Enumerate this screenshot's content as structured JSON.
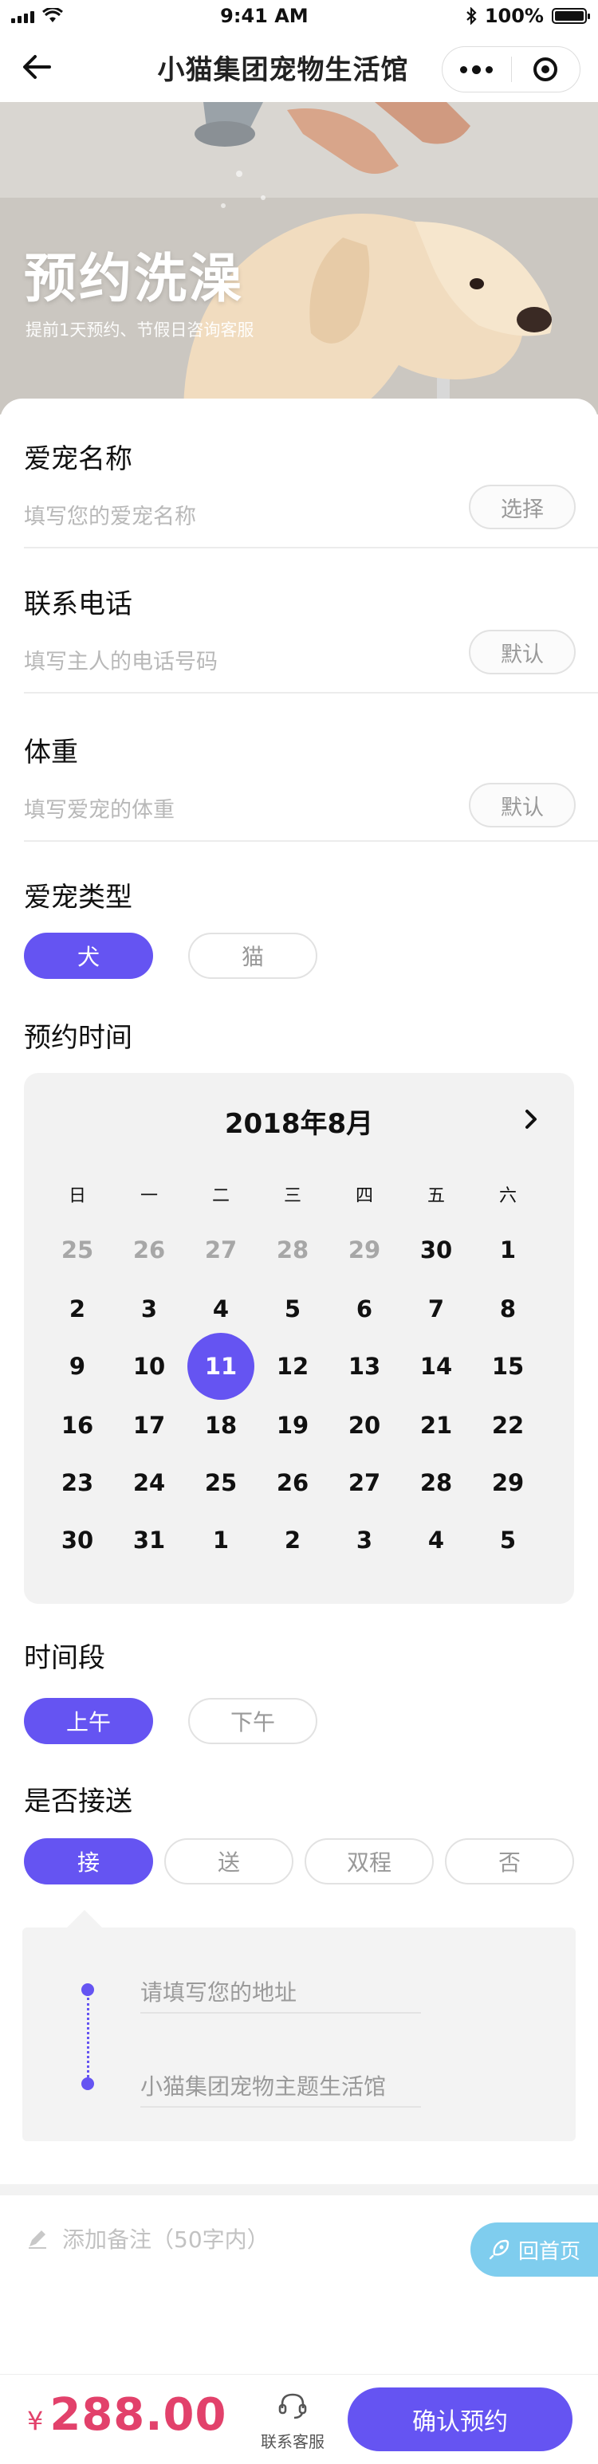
{
  "status_bar": {
    "time": "9:41 AM",
    "battery": "100%",
    "battery_level": 1.0
  },
  "nav": {
    "title": "小猫集团宠物生活馆"
  },
  "hero": {
    "title": "预约洗澡",
    "subtitle": "提前1天预约、节假日咨询客服"
  },
  "form": {
    "pet_name": {
      "label": "爱宠名称",
      "placeholder": "填写您的爱宠名称",
      "button": "选择"
    },
    "phone": {
      "label": "联系电话",
      "placeholder": "填写主人的电话号码",
      "button": "默认"
    },
    "weight": {
      "label": "体重",
      "placeholder": "填写爱宠的体重",
      "button": "默认"
    },
    "pet_type": {
      "label": "爱宠类型",
      "options": [
        "犬",
        "猫"
      ],
      "selected": "犬"
    },
    "booking_time": {
      "label": "预约时间"
    },
    "time_slot": {
      "label": "时间段",
      "options": [
        "上午",
        "下午"
      ],
      "selected": "上午"
    },
    "pickup": {
      "label": "是否接送",
      "options": [
        "接",
        "送",
        "双程",
        "否"
      ],
      "selected": "接"
    },
    "address": {
      "from_placeholder": "请填写您的地址",
      "to": "小猫集团宠物主题生活馆"
    },
    "note": {
      "placeholder": "添加备注（50字内）"
    }
  },
  "calendar": {
    "month_title": "2018年8月",
    "weekdays": [
      "日",
      "一",
      "二",
      "三",
      "四",
      "五",
      "六"
    ],
    "weeks": [
      [
        "25",
        "26",
        "27",
        "28",
        "29",
        "30",
        "1"
      ],
      [
        "2",
        "3",
        "4",
        "5",
        "6",
        "7",
        "8"
      ],
      [
        "9",
        "10",
        "11",
        "12",
        "13",
        "14",
        "15"
      ],
      [
        "16",
        "17",
        "18",
        "19",
        "20",
        "21",
        "22"
      ],
      [
        "23",
        "24",
        "25",
        "26",
        "27",
        "28",
        "29"
      ],
      [
        "30",
        "31",
        "1",
        "2",
        "3",
        "4",
        "5"
      ]
    ],
    "muted_first_row": [
      "25",
      "26",
      "27",
      "28",
      "29"
    ],
    "selected": "11"
  },
  "home_button": {
    "label": "回首页"
  },
  "bottom": {
    "currency": "¥",
    "price": "288.00",
    "service_label": "联系客服",
    "confirm_label": "确认预约"
  },
  "colors": {
    "accent": "#6554f2",
    "price": "#e2416b",
    "home_button": "#7fcdee"
  },
  "icons": [
    "back-arrow-icon",
    "more-dots-icon",
    "target-icon",
    "chevron-right-icon",
    "pencil-icon",
    "rocket-icon",
    "headset-icon"
  ]
}
